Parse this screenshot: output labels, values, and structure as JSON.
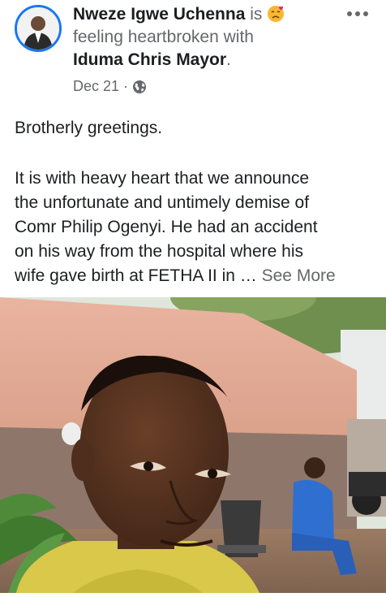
{
  "post": {
    "author": "Nweze Igwe Uchenna",
    "is_word": "is",
    "feeling_text": "feeling heartbroken with",
    "tagged_user": "Iduma Chris Mayor",
    "period": ".",
    "date": "Dec 21",
    "date_sep": "·",
    "privacy_icon": "globe-icon",
    "greeting": "Brotherly greetings.",
    "body_lines": [
      "It is with heavy heart that we announce",
      "the unfortunate and untimely demise of",
      "Comr Philip Ogenyi. He had an accident",
      "on his way from the hospital where his",
      "wife gave birth at FETHA II in … "
    ],
    "see_more": "See More"
  },
  "colors": {
    "accent": "#1877f2",
    "secondary_text": "#65676b",
    "primary_text": "#1c1e21"
  }
}
